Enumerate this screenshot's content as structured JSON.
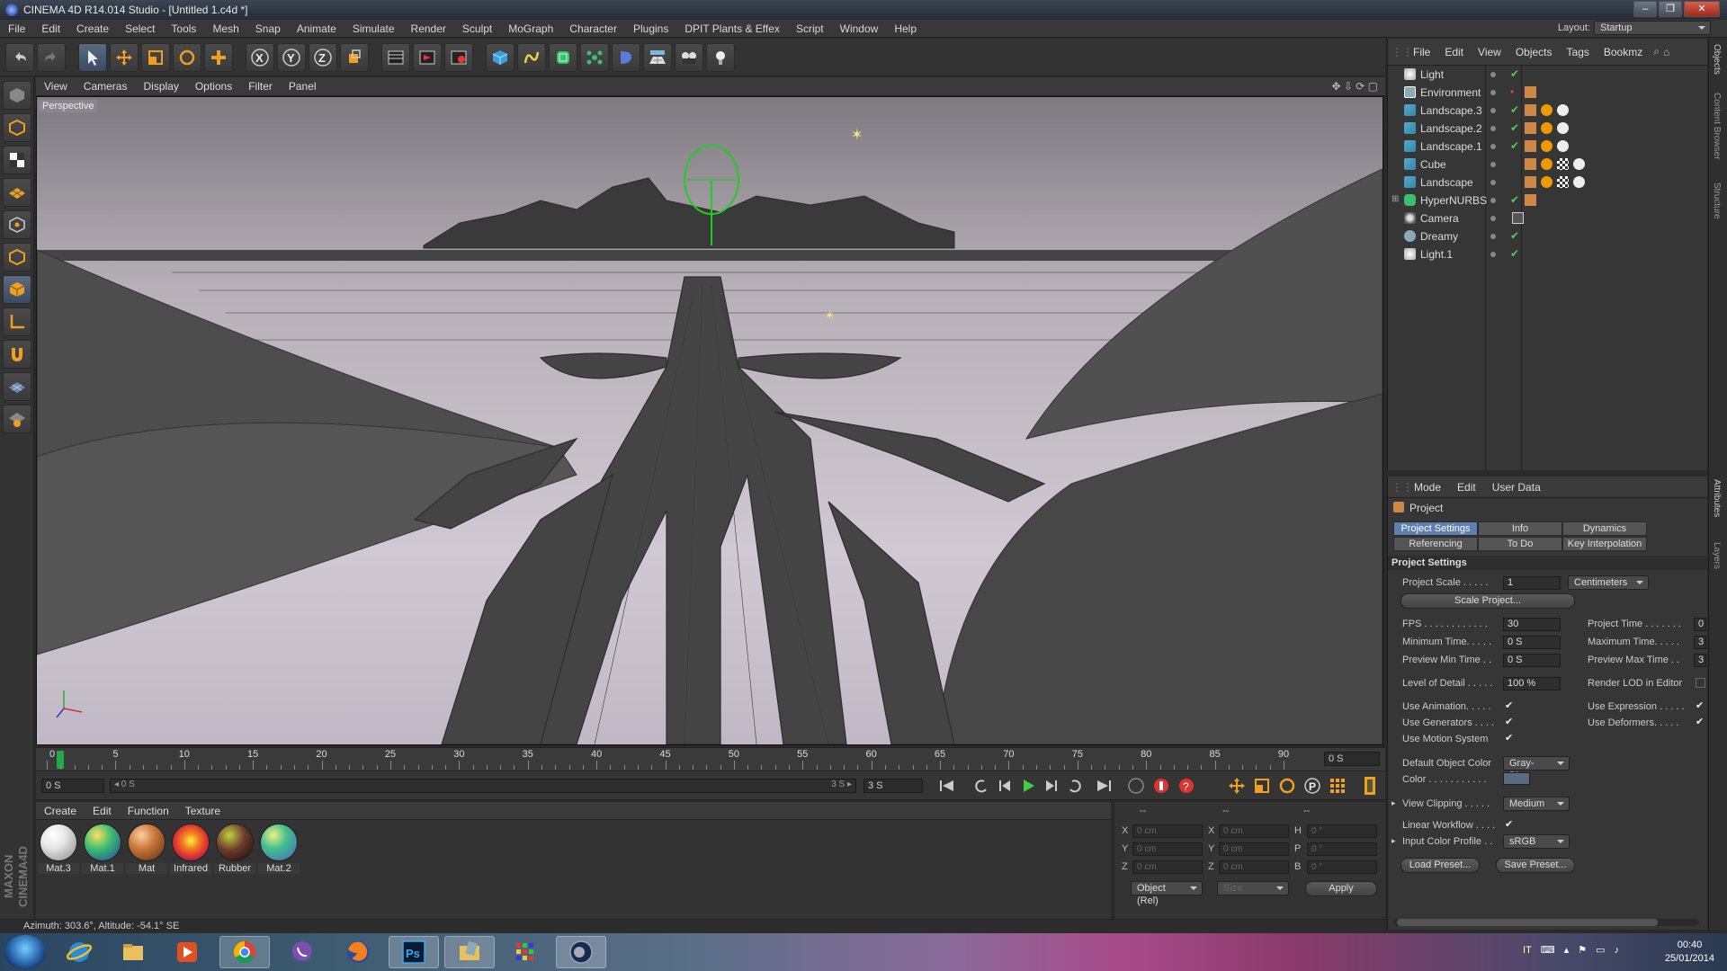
{
  "window": {
    "title": "CINEMA 4D R14.014 Studio - [Untitled 1.c4d *]",
    "controls": [
      "–",
      "❐",
      "✕"
    ]
  },
  "menubar": {
    "items": [
      "File",
      "Edit",
      "Create",
      "Select",
      "Tools",
      "Mesh",
      "Snap",
      "Animate",
      "Simulate",
      "Render",
      "Sculpt",
      "MoGraph",
      "Character",
      "Plugins",
      "DPIT Plants & Effex",
      "Script",
      "Window",
      "Help"
    ],
    "layout_label": "Layout:",
    "layout_value": "Startup"
  },
  "toolbar": {
    "icons": [
      "undo-icon",
      "redo-icon",
      "select-icon",
      "move-icon",
      "scale-icon",
      "rotate-icon",
      "add-icon",
      "x-axis-icon",
      "y-axis-icon",
      "z-axis-icon",
      "world-icon",
      "render-view-icon",
      "render-picture-icon",
      "render-settings-icon",
      "cube-icon",
      "spline-icon",
      "nurbs-icon",
      "array-icon",
      "deformer-icon",
      "floor-icon",
      "camera-icon",
      "light-icon"
    ]
  },
  "viewport": {
    "menu": [
      "View",
      "Cameras",
      "Display",
      "Options",
      "Filter",
      "Panel"
    ],
    "label": "Perspective"
  },
  "timeline": {
    "ticks": [
      "0",
      "5",
      "10",
      "15",
      "20",
      "25",
      "30",
      "35",
      "40",
      "45",
      "50",
      "55",
      "60",
      "65",
      "70",
      "75",
      "80",
      "85",
      "90"
    ],
    "current_field": "0 S",
    "start_field": "0 S",
    "range_start": "◂ 0 S",
    "range_end": "3 S ▸",
    "end_field": "3 S"
  },
  "materials": {
    "menu": [
      "Create",
      "Edit",
      "Function",
      "Texture"
    ],
    "items": [
      {
        "name": "Mat.3",
        "color": "#e8e8e8"
      },
      {
        "name": "Mat.1",
        "color": "#3fbf6f"
      },
      {
        "name": "Mat",
        "color": "#c8783a"
      },
      {
        "name": "Infrared",
        "color": "#e03030"
      },
      {
        "name": "Rubber",
        "color": "#6a3a2a"
      },
      {
        "name": "Mat.2",
        "color": "#3fbf8f"
      }
    ]
  },
  "coordinates": {
    "header": [
      "--",
      "--",
      "--"
    ],
    "rows": [
      {
        "a": "X",
        "av": "0 cm",
        "b": "X",
        "bv": "0 cm",
        "c": "H",
        "cv": "0 °"
      },
      {
        "a": "Y",
        "av": "0 cm",
        "b": "Y",
        "bv": "0 cm",
        "c": "P",
        "cv": "0 °"
      },
      {
        "a": "Z",
        "av": "0 cm",
        "b": "Z",
        "bv": "0 cm",
        "c": "B",
        "cv": "0 °"
      }
    ],
    "mode": "Object (Rel)",
    "size": "Size",
    "apply": "Apply"
  },
  "status": {
    "text": "Azimuth: 303.6°, Altitude: -54.1°  SE"
  },
  "objects": {
    "menu": [
      "File",
      "Edit",
      "View",
      "Objects",
      "Tags",
      "Bookmz"
    ],
    "items": [
      {
        "name": "Light",
        "color": "#ddd"
      },
      {
        "name": "Environment",
        "color": "#8ab"
      },
      {
        "name": "Landscape.3",
        "color": "#5ab"
      },
      {
        "name": "Landscape.2",
        "color": "#5ab"
      },
      {
        "name": "Landscape.1",
        "color": "#5ab"
      },
      {
        "name": "Cube",
        "color": "#5ab"
      },
      {
        "name": "Landscape",
        "color": "#5ab"
      },
      {
        "name": "HyperNURBS",
        "color": "#5c8"
      },
      {
        "name": "Camera",
        "color": "#aaa"
      },
      {
        "name": "Dreamy",
        "color": "#8ab"
      },
      {
        "name": "Light.1",
        "color": "#ddd"
      }
    ]
  },
  "attributes": {
    "menu": [
      "Mode",
      "Edit",
      "User Data"
    ],
    "object": "Project",
    "tabs": [
      "Project Settings",
      "Info",
      "Dynamics",
      "Referencing",
      "To Do",
      "Key Interpolation"
    ],
    "section": "Project Settings",
    "project_scale_label": "Project Scale . . . . .",
    "project_scale": "1",
    "unit": "Centimeters",
    "scale_button": "Scale Project...",
    "fps_label": "FPS . . . . . . . . . . . .",
    "fps": "30",
    "project_time_label": "Project Time . . . . . . .",
    "project_time": "0",
    "min_time_label": "Minimum Time. . . . .",
    "min_time": "0 S",
    "max_time_label": "Maximum Time. . . . .",
    "max_time": "3",
    "prev_min_label": "Preview Min Time . .",
    "prev_min": "0 S",
    "prev_max_label": "Preview Max Time . .",
    "prev_max": "3",
    "lod_label": "Level of Detail . . . . .",
    "lod": "100 %",
    "render_lod_label": "Render LOD in Editor",
    "use_anim_label": "Use Animation. . . . .",
    "use_expr_label": "Use Expression . . . . .",
    "use_gen_label": "Use Generators . . . .",
    "use_def_label": "Use Deformers. . . . .",
    "use_motion_label": "Use Motion System",
    "def_color_label": "Default Object Color",
    "def_color": "Gray-Blue",
    "color_label": "Color . . . . . . . . . . .",
    "view_clip_label": "View Clipping . . . . .",
    "view_clip": "Medium",
    "linear_label": "Linear Workflow . . . .",
    "input_profile_label": "Input Color Profile . .",
    "input_profile": "sRGB",
    "load_preset": "Load Preset...",
    "save_preset": "Save Preset..."
  },
  "right_tabs": [
    "Objects",
    "Content Browser",
    "Structure",
    "Attributes",
    "Layers"
  ],
  "taskbar": {
    "lang": "IT",
    "time": "00:40",
    "date": "25/01/2014",
    "apps": [
      "ie-icon",
      "explorer-icon",
      "media-player-icon",
      "chrome-icon",
      "viber-icon",
      "firefox-icon",
      "photoshop-icon",
      "folder-icon",
      "app-grid-icon",
      "cinema4d-icon"
    ]
  }
}
